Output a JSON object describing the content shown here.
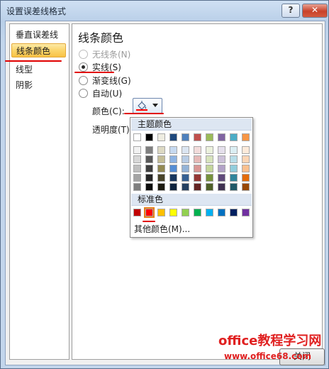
{
  "window": {
    "title": "设置误差线格式",
    "help_label": "?",
    "close_label": "✕"
  },
  "nav": {
    "items": [
      {
        "label": "垂直误差线",
        "selected": false
      },
      {
        "label": "线条颜色",
        "selected": true
      },
      {
        "label": "线型",
        "selected": false
      },
      {
        "label": "阴影",
        "selected": false
      }
    ]
  },
  "panel": {
    "heading": "线条颜色",
    "options": [
      {
        "label": "无线条(N)",
        "checked": false,
        "disabled": true
      },
      {
        "label": "实线(S)",
        "checked": true,
        "disabled": false
      },
      {
        "label": "渐变线(G)",
        "checked": false,
        "disabled": false
      },
      {
        "label": "自动(U)",
        "checked": false,
        "disabled": false
      }
    ],
    "color_label": "颜色(C):",
    "transparency_label": "透明度(T):"
  },
  "color_popup": {
    "theme_heading": "主题颜色",
    "standard_heading": "标准色",
    "more_colors": "其他颜色(M)...",
    "theme_base": [
      "#ffffff",
      "#000000",
      "#eeece1",
      "#1f497d",
      "#4f81bd",
      "#c0504d",
      "#9bbb59",
      "#8064a2",
      "#4bacc6",
      "#f79646"
    ],
    "theme_shades": [
      [
        "#f2f2f2",
        "#d8d8d8",
        "#bfbfbf",
        "#a5a5a5",
        "#7f7f7f"
      ],
      [
        "#7f7f7f",
        "#595959",
        "#3f3f3f",
        "#262626",
        "#0c0c0c"
      ],
      [
        "#ddd9c3",
        "#c4bd97",
        "#938953",
        "#494429",
        "#1d1b10"
      ],
      [
        "#c6d9f0",
        "#8db3e2",
        "#548dd4",
        "#17365d",
        "#0f243e"
      ],
      [
        "#dbe5f1",
        "#b8cce4",
        "#95b3d7",
        "#366092",
        "#244061"
      ],
      [
        "#f2dcdb",
        "#e5b9b7",
        "#d99694",
        "#953734",
        "#632423"
      ],
      [
        "#ebf1dd",
        "#d7e3bc",
        "#c3d69b",
        "#76923c",
        "#4f6128"
      ],
      [
        "#e5e0ec",
        "#ccc1d9",
        "#b2a2c7",
        "#5f497a",
        "#3f3151"
      ],
      [
        "#dbeef3",
        "#b7dde8",
        "#92cddc",
        "#31859b",
        "#205867"
      ],
      [
        "#fdeada",
        "#fbd5b5",
        "#fac08f",
        "#e36c09",
        "#974806"
      ]
    ],
    "standard": [
      "#c00000",
      "#ff0000",
      "#ffc000",
      "#ffff00",
      "#92d050",
      "#00b050",
      "#00b0f0",
      "#0070c0",
      "#002060",
      "#7030a0"
    ],
    "selected_standard_index": 1
  },
  "footer": {
    "close_button": "关闭"
  },
  "watermark": {
    "line1": "office教程学习网",
    "line2": "www.office68.com"
  }
}
